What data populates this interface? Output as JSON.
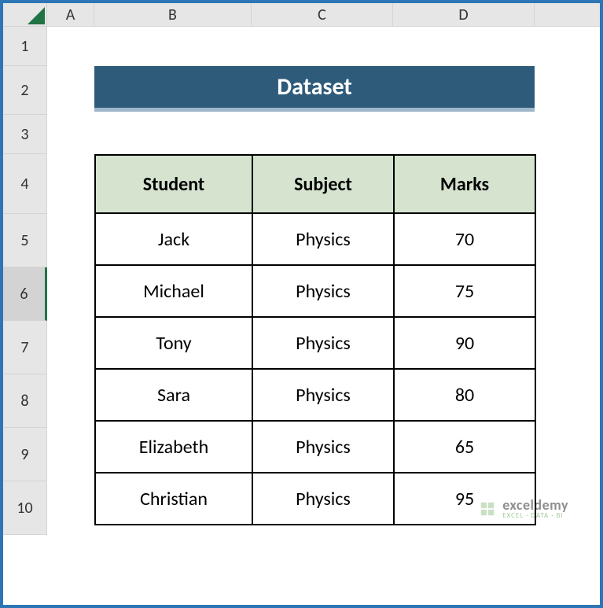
{
  "columns": {
    "A": "A",
    "B": "B",
    "C": "C",
    "D": "D"
  },
  "rows": {
    "r1": "1",
    "r2": "2",
    "r3": "3",
    "r4": "4",
    "r5": "5",
    "r6": "6",
    "r7": "7",
    "r8": "8",
    "r9": "9",
    "r10": "10"
  },
  "banner": {
    "title": "Dataset"
  },
  "table": {
    "headers": {
      "student": "Student",
      "subject": "Subject",
      "marks": "Marks"
    },
    "rows": [
      {
        "student": "Jack",
        "subject": "Physics",
        "marks": "70"
      },
      {
        "student": "Michael",
        "subject": "Physics",
        "marks": "75"
      },
      {
        "student": "Tony",
        "subject": "Physics",
        "marks": "90"
      },
      {
        "student": "Sara",
        "subject": "Physics",
        "marks": "80"
      },
      {
        "student": "Elizabeth",
        "subject": "Physics",
        "marks": "65"
      },
      {
        "student": "Christian",
        "subject": "Physics",
        "marks": "95"
      }
    ]
  },
  "watermark": {
    "main": "exceldemy",
    "sub": "EXCEL · DATA · BI"
  }
}
